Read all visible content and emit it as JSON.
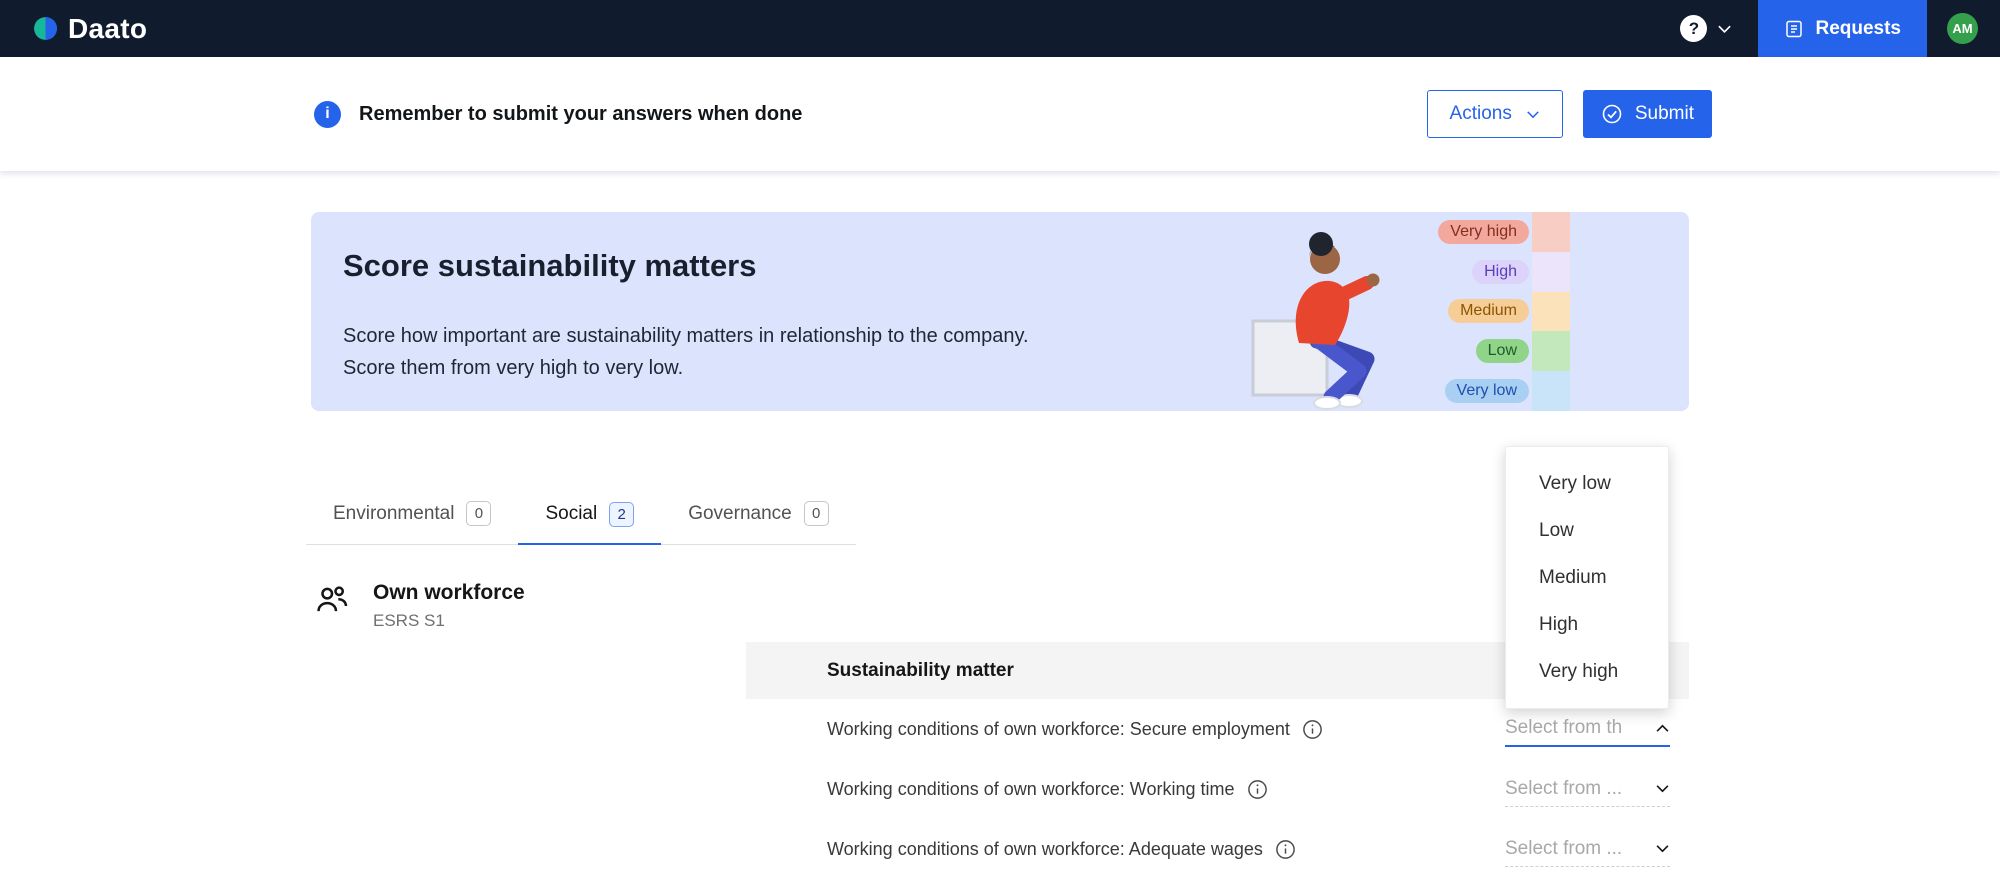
{
  "colors": {
    "accent": "#2563eb",
    "navbar-bg": "#101b2e",
    "banner-bg": "#dbe4fc",
    "avatar-bg": "#35a04c",
    "table-header-bg": "#f4f4f4"
  },
  "navbar": {
    "brand": "Daato",
    "help_label": "?",
    "requests_label": "Requests",
    "avatar_initials": "AM"
  },
  "subheader": {
    "notice": "Remember to submit your answers when done",
    "actions_label": "Actions",
    "submit_label": "Submit"
  },
  "banner": {
    "title": "Score sustainability matters",
    "body_line1": "Score how important are sustainability matters in relationship to the company.",
    "body_line2": "Score them from very high to very low.",
    "scale": [
      {
        "label": "Very high",
        "pill_bg": "#f2a89d",
        "pill_text": "#842e1d",
        "bar_color": "#f8cdc4"
      },
      {
        "label": "High",
        "pill_bg": "#ddd2f9",
        "pill_text": "#5b3db8",
        "bar_color": "#ece4fb"
      },
      {
        "label": "Medium",
        "pill_bg": "#f6cd97",
        "pill_text": "#8a5600",
        "bar_color": "#fbe2ba"
      },
      {
        "label": "Low",
        "pill_bg": "#90d489",
        "pill_text": "#1d5c2a",
        "bar_color": "#c2e8bc"
      },
      {
        "label": "Very low",
        "pill_bg": "#a9cff3",
        "pill_text": "#1f4fae",
        "bar_color": "#c9e3f8"
      }
    ]
  },
  "tabs": [
    {
      "label": "Environmental",
      "count": "0"
    },
    {
      "label": "Social",
      "count": "2"
    },
    {
      "label": "Governance",
      "count": "0"
    }
  ],
  "section": {
    "title": "Own workforce",
    "subtitle": "ESRS S1"
  },
  "table": {
    "header": "Sustainability matter",
    "rows": [
      {
        "label": "Working conditions of own workforce: Secure employment",
        "select_value": "Select from th"
      },
      {
        "label": "Working conditions of own workforce: Working time",
        "select_value": "Select from ..."
      },
      {
        "label": "Working conditions of own workforce: Adequate wages",
        "select_value": "Select from ..."
      }
    ]
  },
  "dropdown": {
    "options": [
      "Very low",
      "Low",
      "Medium",
      "High",
      "Very high"
    ]
  }
}
